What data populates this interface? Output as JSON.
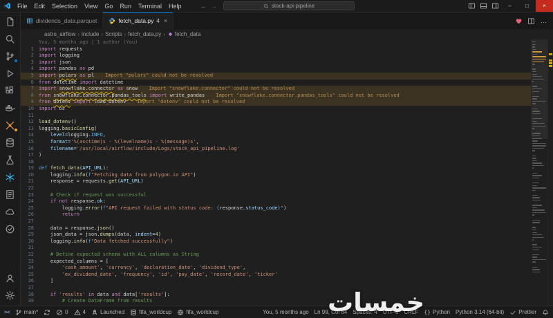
{
  "app": {
    "accent": "#0078d4",
    "warning_color": "#cca700",
    "editor_bg": "#1f1f1f"
  },
  "titlebar": {
    "menus": [
      "File",
      "Edit",
      "Selection",
      "View",
      "Go",
      "Run",
      "Terminal",
      "Help"
    ],
    "nav_back": "←",
    "nav_forward": "→",
    "command_center": "stock-api-pipeline",
    "window_controls": {
      "minimize": "–",
      "maximize": "□",
      "close": "×"
    }
  },
  "activity_bar": {
    "top": [
      {
        "icon": "explorer"
      },
      {
        "icon": "search"
      },
      {
        "icon": "scm",
        "badge": "blue"
      },
      {
        "icon": "debug"
      },
      {
        "icon": "extensions"
      },
      {
        "icon": "docker"
      },
      {
        "icon": "airflow",
        "color": "#e8984a",
        "badge": "orange"
      },
      {
        "icon": "database"
      },
      {
        "icon": "beaker"
      },
      {
        "icon": "snowflake",
        "color": "#3fb5e5"
      },
      {
        "icon": "notebook"
      },
      {
        "icon": "cloud"
      },
      {
        "icon": "todo"
      }
    ],
    "bottom": [
      {
        "icon": "accounts"
      },
      {
        "icon": "gear"
      }
    ]
  },
  "tabs": [
    {
      "label": "dividends_data.parquet",
      "icon": "parquet",
      "icon_color": "#58a6d8",
      "active": false
    },
    {
      "label": "fetch_data.py",
      "icon": "python",
      "active": true,
      "badge": "4",
      "close": "×"
    }
  ],
  "editor_actions": [
    {
      "icon": "heart",
      "name": "heart-action"
    },
    {
      "icon": "split",
      "name": "split-editor-action"
    },
    {
      "icon": "more",
      "glyph": "…",
      "name": "more-actions"
    }
  ],
  "breadcrumbs": [
    {
      "label": "astro_airflow"
    },
    {
      "label": "include"
    },
    {
      "label": "Scripts"
    },
    {
      "label": "fetch_data.py"
    },
    {
      "label": "fetch_data",
      "icon": "method"
    }
  ],
  "editor": {
    "annotation": "You, 5 months ago | 1 author (You)",
    "lines": [
      {
        "n": 1,
        "t": [
          [
            "k",
            "import"
          ],
          [
            "t",
            " requests"
          ]
        ]
      },
      {
        "n": 2,
        "t": [
          [
            "k",
            "import"
          ],
          [
            "t",
            " logging"
          ]
        ]
      },
      {
        "n": 3,
        "t": [
          [
            "k",
            "import"
          ],
          [
            "t",
            " json"
          ]
        ]
      },
      {
        "n": 4,
        "t": [
          [
            "k",
            "import"
          ],
          [
            "t",
            " pandas "
          ],
          [
            "k",
            "as"
          ],
          [
            "t",
            " pd"
          ]
        ]
      },
      {
        "n": 5,
        "warn": true,
        "msg": "Import \"polars\" could not be resolved",
        "t": [
          [
            "k",
            "import"
          ],
          [
            "t",
            " "
          ],
          [
            "u",
            "polars"
          ],
          [
            "t",
            " "
          ],
          [
            "k",
            "as"
          ],
          [
            "t",
            " pl"
          ]
        ]
      },
      {
        "n": 6,
        "t": [
          [
            "k",
            "from"
          ],
          [
            "t",
            " datetime "
          ],
          [
            "k",
            "import"
          ],
          [
            "t",
            " datetime"
          ]
        ]
      },
      {
        "n": 7,
        "warn": true,
        "msg": "Import \"snowflake.connector\" could not be resolved",
        "t": [
          [
            "k",
            "import"
          ],
          [
            "t",
            " "
          ],
          [
            "u",
            "snowflake.connector"
          ],
          [
            "t",
            " "
          ],
          [
            "k",
            "as"
          ],
          [
            "t",
            " snow"
          ]
        ]
      },
      {
        "n": 8,
        "warn": true,
        "msg": "Import \"snowflake.connector.pandas_tools\" could not be resolved",
        "t": [
          [
            "k",
            "from"
          ],
          [
            "t",
            " "
          ],
          [
            "u",
            "snowflake.connector.pandas_tools"
          ],
          [
            "t",
            " "
          ],
          [
            "k",
            "import"
          ],
          [
            "t",
            " write_pandas"
          ]
        ]
      },
      {
        "n": 9,
        "warn": true,
        "msg": "Import \"dotenv\" could not be resolved",
        "t": [
          [
            "k",
            "from"
          ],
          [
            "t",
            " "
          ],
          [
            "u",
            "dotenv"
          ],
          [
            "t",
            " "
          ],
          [
            "k",
            "import"
          ],
          [
            "t",
            " load_dotenv"
          ]
        ]
      },
      {
        "n": 10,
        "t": [
          [
            "k",
            "import"
          ],
          [
            "t",
            " os"
          ]
        ]
      },
      {
        "n": 11,
        "t": []
      },
      {
        "n": 12,
        "t": [
          [
            "f",
            "load_dotenv"
          ],
          [
            "t",
            "()"
          ]
        ]
      },
      {
        "n": 13,
        "t": [
          [
            "t",
            "logging."
          ],
          [
            "f",
            "basicConfig"
          ],
          [
            "t",
            "("
          ]
        ]
      },
      {
        "n": 14,
        "t": [
          [
            "t",
            "    "
          ],
          [
            "v",
            "level"
          ],
          [
            "t",
            "=logging."
          ],
          [
            "c",
            "INFO"
          ],
          [
            "t",
            ","
          ]
        ]
      },
      {
        "n": 15,
        "t": [
          [
            "t",
            "    "
          ],
          [
            "v",
            "format"
          ],
          [
            "t",
            "="
          ],
          [
            "s",
            "'%(asctime)s - %(levelname)s - %(message)s'"
          ],
          [
            "t",
            ","
          ]
        ]
      },
      {
        "n": 16,
        "t": [
          [
            "t",
            "    "
          ],
          [
            "v",
            "filename"
          ],
          [
            "t",
            "="
          ],
          [
            "s",
            "'/usr/local/airflow/include/Logs/stock_api_pipeline.log'"
          ]
        ]
      },
      {
        "n": 17,
        "t": [
          [
            "t",
            ")"
          ]
        ]
      },
      {
        "n": 18,
        "t": []
      },
      {
        "n": 19,
        "t": [
          [
            "d",
            "def"
          ],
          [
            "t",
            " "
          ],
          [
            "f",
            "fetch_data"
          ],
          [
            "t",
            "("
          ],
          [
            "v",
            "API_URL"
          ],
          [
            "t",
            "):"
          ]
        ]
      },
      {
        "n": 20,
        "t": [
          [
            "t",
            "    logging."
          ],
          [
            "f",
            "info"
          ],
          [
            "t",
            "("
          ],
          [
            "d",
            "f"
          ],
          [
            "s",
            "\"Fetching data from polygon.io API\""
          ],
          [
            "t",
            ")"
          ]
        ]
      },
      {
        "n": 21,
        "t": [
          [
            "t",
            "    response = requests."
          ],
          [
            "f",
            "get"
          ],
          [
            "t",
            "("
          ],
          [
            "v",
            "API_URL"
          ],
          [
            "t",
            ")"
          ]
        ]
      },
      {
        "n": 22,
        "t": []
      },
      {
        "n": 23,
        "t": [
          [
            "cm",
            "    # Check if request was successful"
          ]
        ]
      },
      {
        "n": 24,
        "t": [
          [
            "t",
            "    "
          ],
          [
            "k",
            "if"
          ],
          [
            "t",
            " "
          ],
          [
            "k",
            "not"
          ],
          [
            "t",
            " response."
          ],
          [
            "v",
            "ok"
          ],
          [
            "t",
            ":"
          ]
        ]
      },
      {
        "n": 25,
        "t": [
          [
            "t",
            "        logging."
          ],
          [
            "f",
            "error"
          ],
          [
            "t",
            "("
          ],
          [
            "d",
            "f"
          ],
          [
            "s",
            "\"API request failed with status code: "
          ],
          [
            "d",
            "{"
          ],
          [
            "t",
            "response."
          ],
          [
            "v",
            "status_code"
          ],
          [
            "d",
            "}"
          ],
          [
            "s",
            "\""
          ],
          [
            "t",
            ")"
          ]
        ]
      },
      {
        "n": 26,
        "t": [
          [
            "t",
            "        "
          ],
          [
            "k",
            "return"
          ]
        ]
      },
      {
        "n": 27,
        "t": []
      },
      {
        "n": 28,
        "t": [
          [
            "t",
            "    data = response."
          ],
          [
            "f",
            "json"
          ],
          [
            "t",
            "()"
          ]
        ]
      },
      {
        "n": 29,
        "t": [
          [
            "t",
            "    json_data = json."
          ],
          [
            "f",
            "dumps"
          ],
          [
            "t",
            "(data, "
          ],
          [
            "v",
            "indent"
          ],
          [
            "t",
            "="
          ],
          [
            "n2",
            "4"
          ],
          [
            "t",
            ")"
          ]
        ]
      },
      {
        "n": 30,
        "t": [
          [
            "t",
            "    logging."
          ],
          [
            "f",
            "info"
          ],
          [
            "t",
            "("
          ],
          [
            "d",
            "f"
          ],
          [
            "s",
            "\"Data fetched successfully\""
          ],
          [
            "t",
            ")"
          ]
        ]
      },
      {
        "n": 31,
        "t": []
      },
      {
        "n": 32,
        "t": [
          [
            "cm",
            "    # Define expected schema with ALL columns as String"
          ]
        ]
      },
      {
        "n": 33,
        "t": [
          [
            "t",
            "    expected_columns = ["
          ]
        ]
      },
      {
        "n": 34,
        "t": [
          [
            "t",
            "        "
          ],
          [
            "s",
            "'cash_amount'"
          ],
          [
            "t",
            ", "
          ],
          [
            "s",
            "'currency'"
          ],
          [
            "t",
            ", "
          ],
          [
            "s",
            "'declaration_date'"
          ],
          [
            "t",
            ", "
          ],
          [
            "s",
            "'dividend_type'"
          ],
          [
            "t",
            ","
          ]
        ]
      },
      {
        "n": 35,
        "t": [
          [
            "t",
            "        "
          ],
          [
            "s",
            "'ex_dividend_date'"
          ],
          [
            "t",
            ", "
          ],
          [
            "s",
            "'frequency'"
          ],
          [
            "t",
            ", "
          ],
          [
            "s",
            "'id'"
          ],
          [
            "t",
            ", "
          ],
          [
            "s",
            "'pay_date'"
          ],
          [
            "t",
            ", "
          ],
          [
            "s",
            "'record_date'"
          ],
          [
            "t",
            ", "
          ],
          [
            "s",
            "'ticker'"
          ]
        ]
      },
      {
        "n": 36,
        "t": [
          [
            "t",
            "    ]"
          ]
        ]
      },
      {
        "n": 37,
        "t": []
      },
      {
        "n": 38,
        "t": [
          [
            "t",
            "    "
          ],
          [
            "k",
            "if"
          ],
          [
            "t",
            " "
          ],
          [
            "s",
            "'results'"
          ],
          [
            "t",
            " "
          ],
          [
            "k",
            "in"
          ],
          [
            "t",
            " data "
          ],
          [
            "k",
            "and"
          ],
          [
            "t",
            " data["
          ],
          [
            "s",
            "'results'"
          ],
          [
            "t",
            "]:"
          ]
        ]
      },
      {
        "n": 39,
        "t": [
          [
            "cm",
            "        # Create DataFrame from results"
          ]
        ]
      }
    ]
  },
  "status_bar": {
    "left": [
      {
        "icon": "remote",
        "label": "",
        "name": "remote-indicator"
      },
      {
        "icon": "branch",
        "label": "main*",
        "name": "git-branch"
      },
      {
        "icon": "sync",
        "label": "",
        "name": "git-sync"
      },
      {
        "icon": "error",
        "label": "0",
        "name": "problems-errors"
      },
      {
        "icon": "warning",
        "label": "4",
        "name": "problems-warnings"
      },
      {
        "icon": "rocket",
        "label": "Launched",
        "name": "launch-status"
      },
      {
        "icon": "database",
        "label": "fifa_worldcup",
        "name": "db-connection"
      },
      {
        "icon": "globe",
        "label": "fifa_worldcup",
        "name": "project-status"
      }
    ],
    "right": [
      {
        "icon": "",
        "label": "You, 5 months ago",
        "name": "blame-status"
      },
      {
        "icon": "",
        "label": "Ln 99, Col 64",
        "name": "cursor-position"
      },
      {
        "icon": "",
        "label": "Spaces: 4",
        "name": "indentation"
      },
      {
        "icon": "",
        "label": "UTF-8",
        "name": "encoding"
      },
      {
        "icon": "",
        "label": "CRLF",
        "name": "eol"
      },
      {
        "icon": "braces",
        "label": "Python",
        "name": "language-mode"
      },
      {
        "icon": "",
        "label": "Python 3.14 (64-bit)",
        "name": "python-interpreter"
      },
      {
        "icon": "check",
        "label": "Prettier",
        "name": "formatter-status"
      },
      {
        "icon": "bell",
        "label": "",
        "name": "notifications-bell"
      }
    ]
  },
  "watermark": "خمسات"
}
